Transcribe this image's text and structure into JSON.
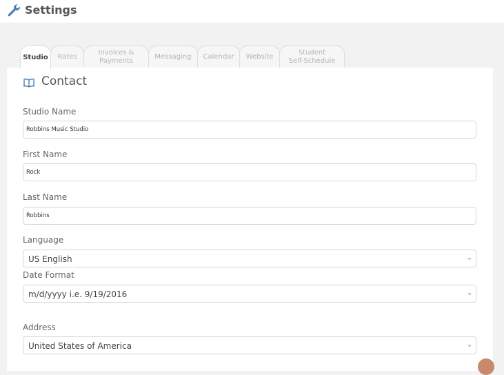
{
  "header": {
    "title": "Settings"
  },
  "tabs": [
    {
      "l1": "Studio",
      "l2": ""
    },
    {
      "l1": "Rates",
      "l2": ""
    },
    {
      "l1": "Invoices &",
      "l2": "Payments"
    },
    {
      "l1": "Messaging",
      "l2": ""
    },
    {
      "l1": "Calendar",
      "l2": ""
    },
    {
      "l1": "Website",
      "l2": ""
    },
    {
      "l1": "Student",
      "l2": "Self-Schedule"
    }
  ],
  "section": {
    "title": "Contact"
  },
  "fields": {
    "studio_name": {
      "label": "Studio Name",
      "value": "Robbins Music Studio"
    },
    "first_name": {
      "label": "First Name",
      "value": "Rock"
    },
    "last_name": {
      "label": "Last Name",
      "value": "Robbins"
    },
    "language": {
      "label": "Language",
      "value": "US English"
    },
    "date_format": {
      "label": "Date Format",
      "value": "m/d/yyyy i.e. 9/19/2016"
    },
    "address": {
      "label": "Address",
      "value": "United States of America"
    }
  },
  "colors": {
    "accent": "#4a7fb5",
    "active_tab_text": "#444444",
    "inactive_tab_text": "#b5b5b5"
  }
}
